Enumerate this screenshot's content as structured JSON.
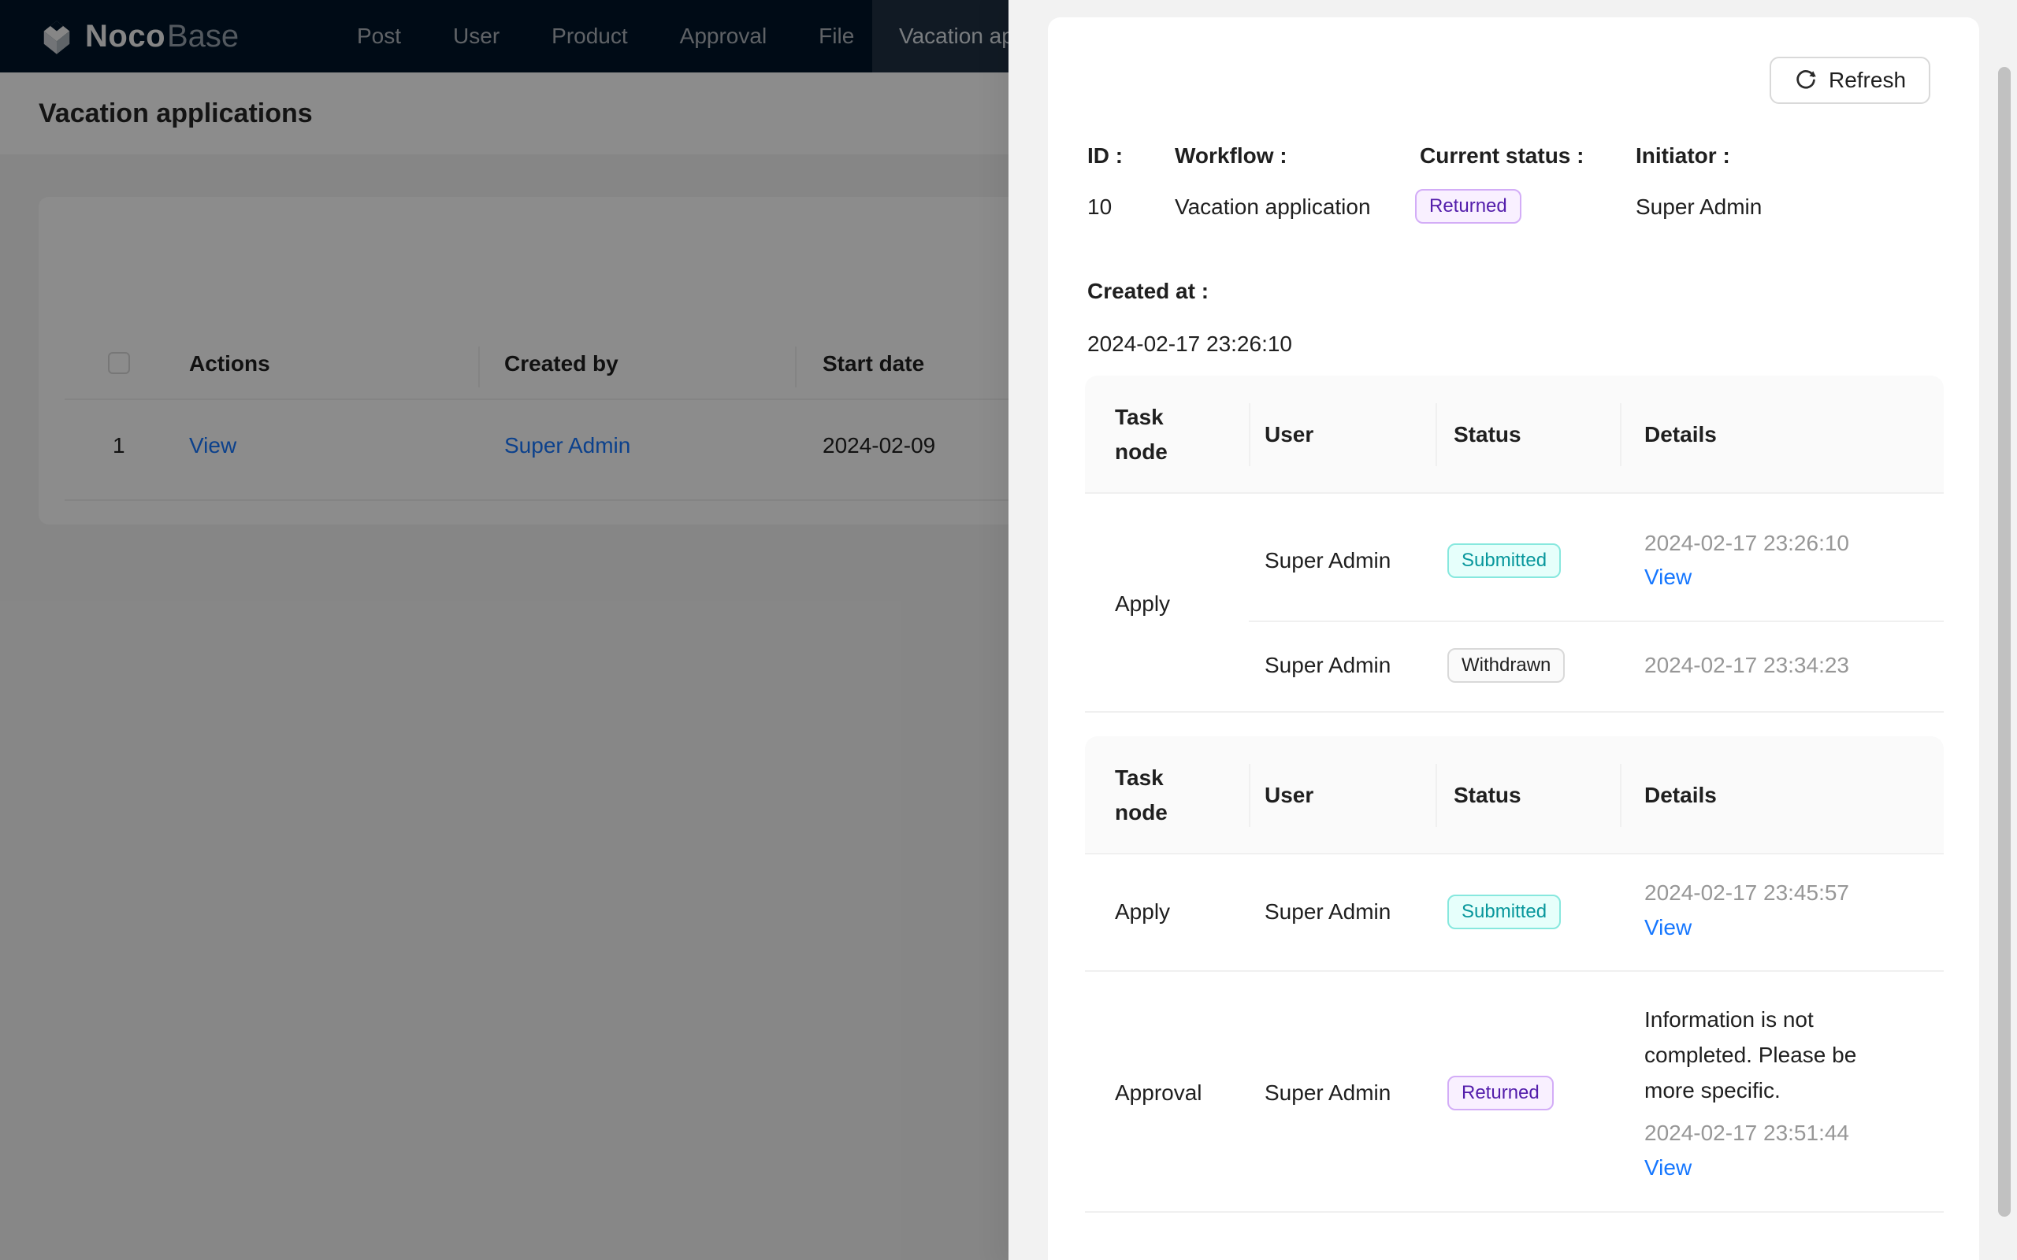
{
  "nav": {
    "brand": {
      "bold": "Noco",
      "light": "Base"
    },
    "items": [
      {
        "label": "Post"
      },
      {
        "label": "User"
      },
      {
        "label": "Product"
      },
      {
        "label": "Approval"
      },
      {
        "label": "File"
      }
    ],
    "active": {
      "label": "Vacation ap"
    }
  },
  "page": {
    "title": "Vacation applications",
    "table": {
      "headers": {
        "actions": "Actions",
        "created_by": "Created by",
        "start_date": "Start date"
      },
      "row": {
        "index": "1",
        "action": "View",
        "created_by": "Super Admin",
        "start_date": "2024-02-09"
      }
    }
  },
  "drawer": {
    "refresh_label": "Refresh",
    "fields": {
      "id": {
        "label": "ID :",
        "value": "10"
      },
      "workflow": {
        "label": "Workflow :",
        "value": "Vacation application"
      },
      "current_status": {
        "label": "Current status :",
        "value": "Returned"
      },
      "initiator": {
        "label": "Initiator :",
        "value": "Super Admin"
      },
      "created_at": {
        "label": "Created at :",
        "value": "2024-02-17 23:26:10"
      }
    },
    "headers": {
      "node": "Task node",
      "user": "User",
      "status": "Status",
      "details": "Details"
    },
    "table1": {
      "node": "Apply",
      "entry1": {
        "user": "Super Admin",
        "status": "Submitted",
        "time": "2024-02-17 23:26:10",
        "link": "View"
      },
      "entry2": {
        "user": "Super Admin",
        "status": "Withdrawn",
        "time": "2024-02-17 23:34:23"
      }
    },
    "table2": {
      "row1": {
        "node": "Apply",
        "user": "Super Admin",
        "status": "Submitted",
        "time": "2024-02-17 23:45:57",
        "link": "View"
      },
      "row2": {
        "node": "Approval",
        "user": "Super Admin",
        "status": "Returned",
        "message": "Information is not completed. Please be more specific.",
        "time": "2024-02-17 23:51:44",
        "link": "View"
      }
    },
    "colors": {
      "accent": "#1677ff",
      "nav_bg": "#001529",
      "status_submitted": "#08979c",
      "status_returned": "#531dab",
      "status_withdrawn": "#000000e0",
      "time_text": "#979797"
    }
  }
}
